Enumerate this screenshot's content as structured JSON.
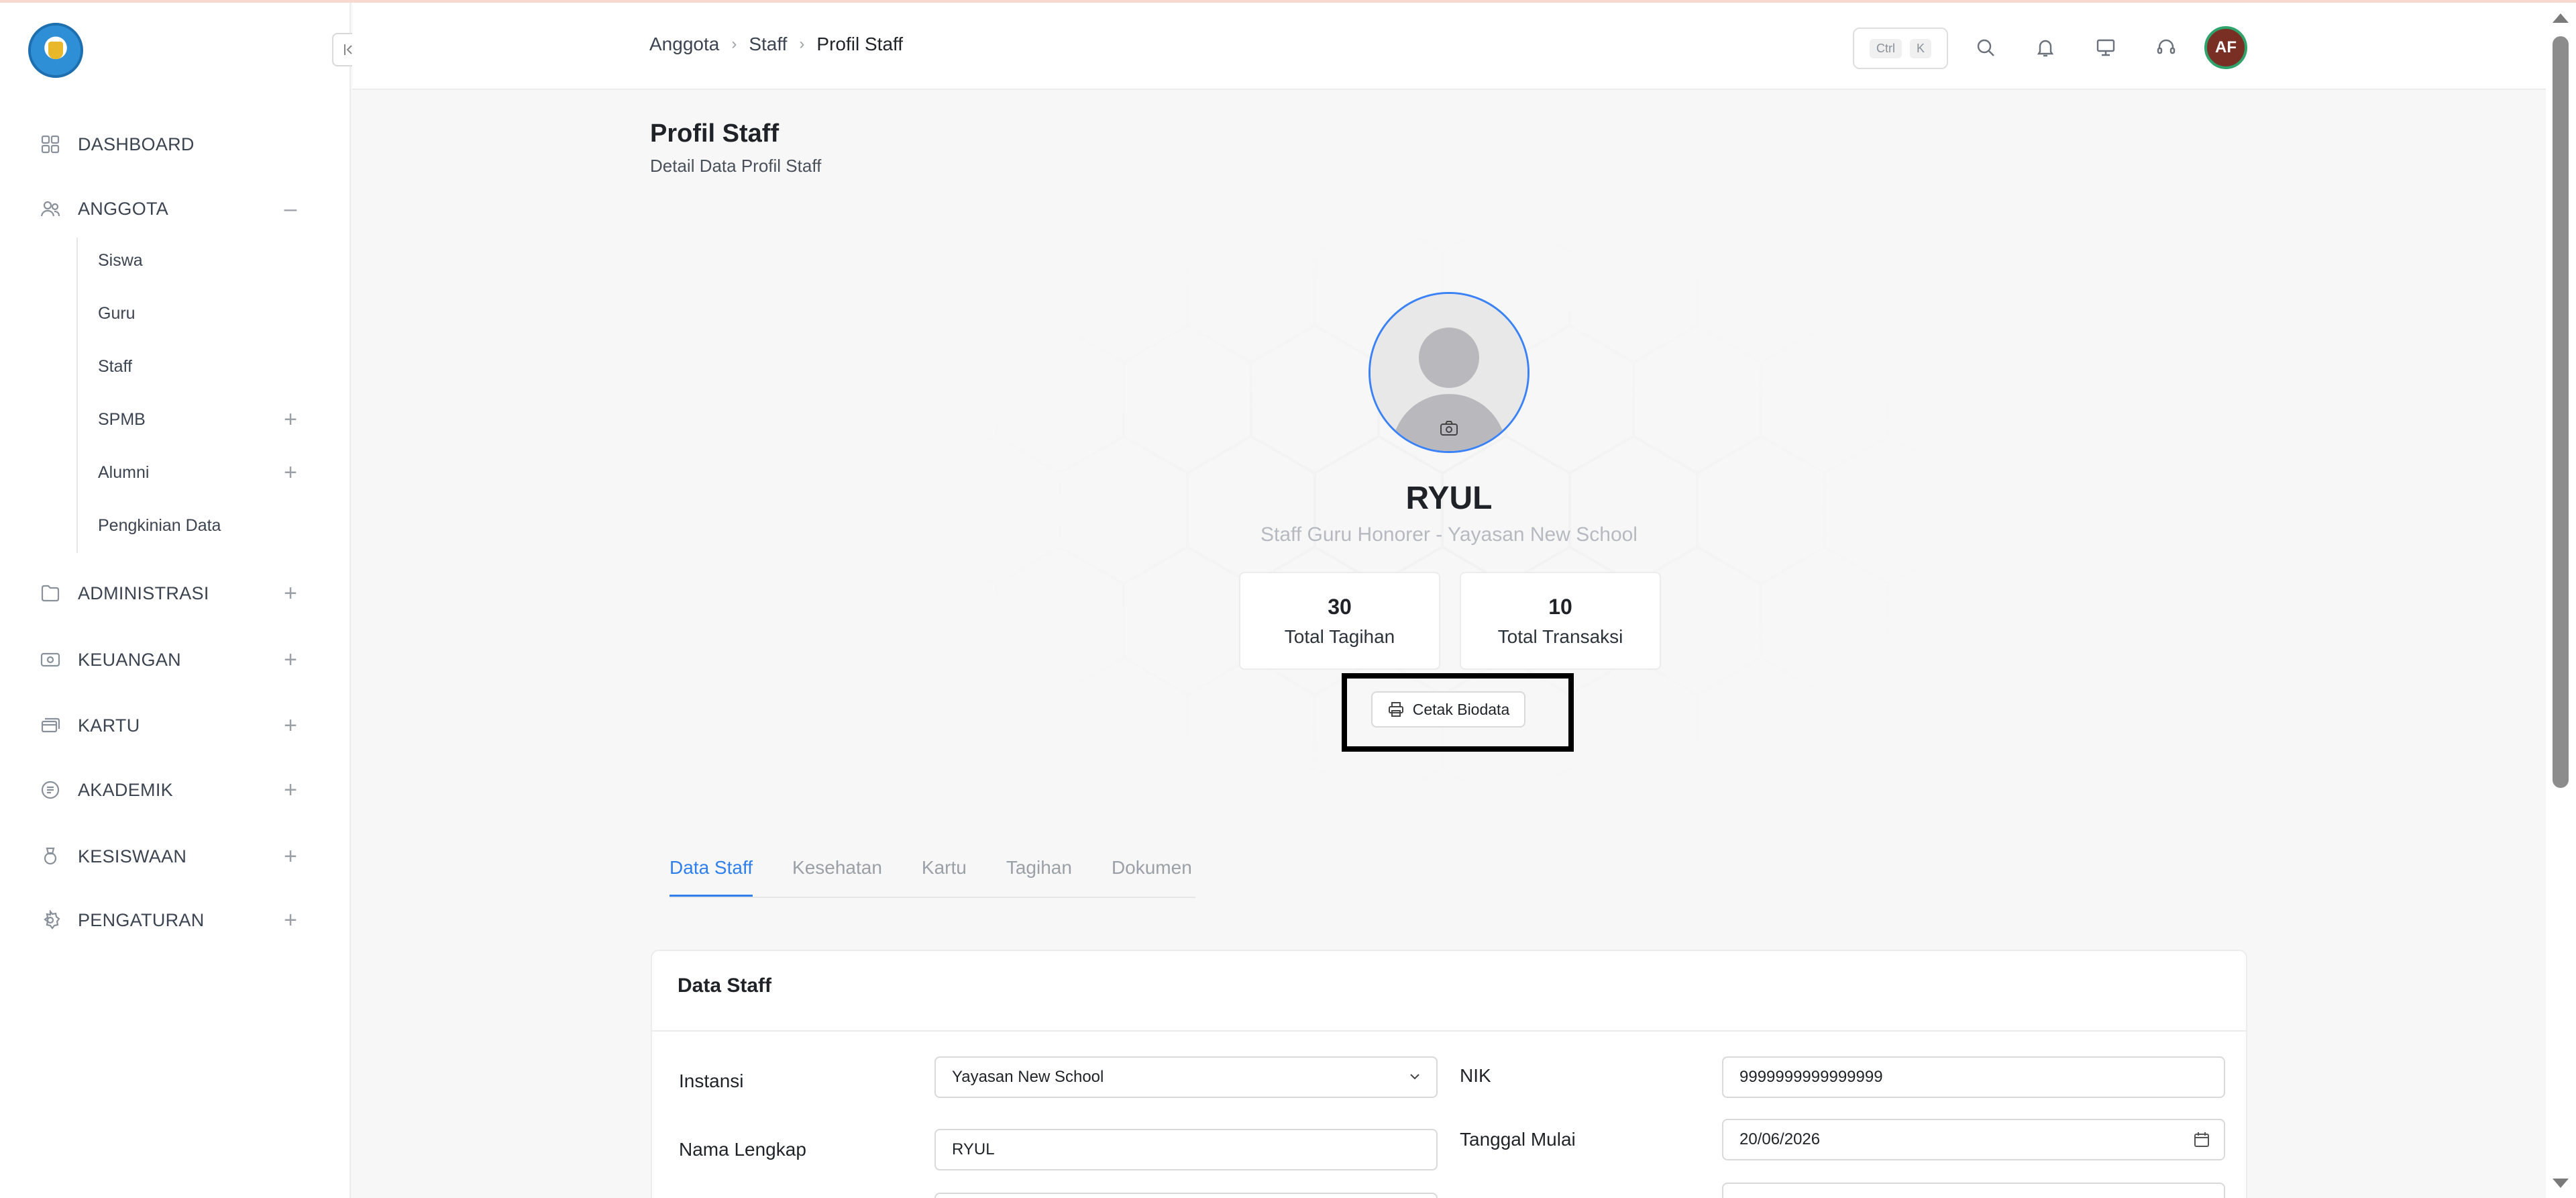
{
  "sidebar": {
    "collapse_icon": "chevron-left-bar-icon",
    "menu": [
      {
        "label": "DASHBOARD",
        "icon": "grid-icon",
        "sign": ""
      },
      {
        "label": "ANGGOTA",
        "icon": "users-icon",
        "sign": "–"
      },
      {
        "label": "ADMINISTRASI",
        "icon": "folder-icon",
        "sign": "+"
      },
      {
        "label": "KEUANGAN",
        "icon": "money-icon",
        "sign": "+"
      },
      {
        "label": "KARTU",
        "icon": "cards-icon",
        "sign": "+"
      },
      {
        "label": "AKADEMIK",
        "icon": "book-icon",
        "sign": "+"
      },
      {
        "label": "KESISWAAN",
        "icon": "medal-icon",
        "sign": "+"
      },
      {
        "label": "PENGATURAN",
        "icon": "gear-icon",
        "sign": "+"
      }
    ],
    "submenu": [
      {
        "label": "Siswa",
        "sign": ""
      },
      {
        "label": "Guru",
        "sign": ""
      },
      {
        "label": "Staff",
        "sign": ""
      },
      {
        "label": "SPMB",
        "sign": "+"
      },
      {
        "label": "Alumni",
        "sign": "+"
      },
      {
        "label": "Pengkinian Data",
        "sign": ""
      }
    ]
  },
  "header": {
    "breadcrumbs": [
      "Anggota",
      "Staff",
      "Profil Staff"
    ],
    "shortcut": {
      "key1": "Ctrl",
      "key2": "K"
    },
    "avatar_initials": "AF"
  },
  "page": {
    "title": "Profil Staff",
    "subtitle": "Detail Data Profil Staff"
  },
  "profile": {
    "name": "RYUL",
    "role": "Staff Guru Honorer - Yayasan New School",
    "stats": [
      {
        "value": "30",
        "label": "Total Tagihan"
      },
      {
        "value": "10",
        "label": "Total Transaksi"
      }
    ],
    "print_label": "Cetak Biodata"
  },
  "tabs": [
    {
      "label": "Data Staff",
      "active": true
    },
    {
      "label": "Kesehatan",
      "active": false
    },
    {
      "label": "Kartu",
      "active": false
    },
    {
      "label": "Tagihan",
      "active": false
    },
    {
      "label": "Dokumen",
      "active": false
    }
  ],
  "form": {
    "card_title": "Data Staff",
    "instansi": {
      "label": "Instansi",
      "value": "Yayasan New School"
    },
    "nama": {
      "label": "Nama Lengkap",
      "value": "RYUL"
    },
    "nik": {
      "label": "NIK",
      "value": "9999999999999999"
    },
    "tanggal": {
      "label": "Tanggal Mulai",
      "value": "20/06/2026"
    }
  },
  "colors": {
    "accent": "#2f80ed",
    "avatar_bg": "#7a2f24",
    "avatar_ring": "#2ea36b",
    "highlight": "#000000"
  }
}
